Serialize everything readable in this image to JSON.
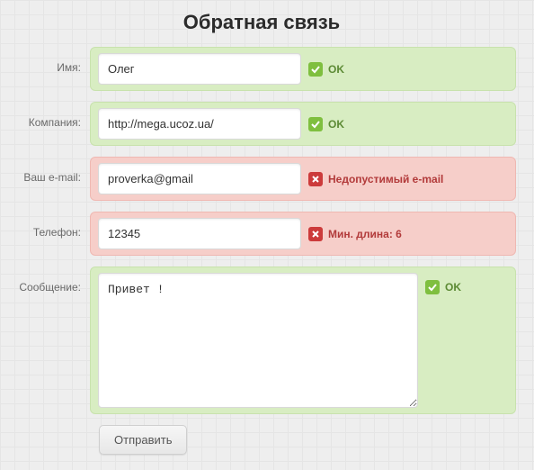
{
  "title": "Обратная связь",
  "labels": {
    "name": "Имя:",
    "company": "Компания:",
    "email": "Ваш e-mail:",
    "phone": "Телефон:",
    "message": "Сообщение:"
  },
  "values": {
    "name": "Олег",
    "company": "http://mega.ucoz.ua/",
    "email": "proverka@gmail",
    "phone": "12345",
    "message": "Привет !"
  },
  "status": {
    "ok": "OK",
    "invalid_email": "Недопустимый e-mail",
    "min_length": "Мин. длина: 6"
  },
  "submit": "Отправить",
  "colors": {
    "ok_bg": "#d8edc2",
    "err_bg": "#f6cec9",
    "ok_icon": "#7fbf3f",
    "err_icon": "#cc3b3b"
  }
}
